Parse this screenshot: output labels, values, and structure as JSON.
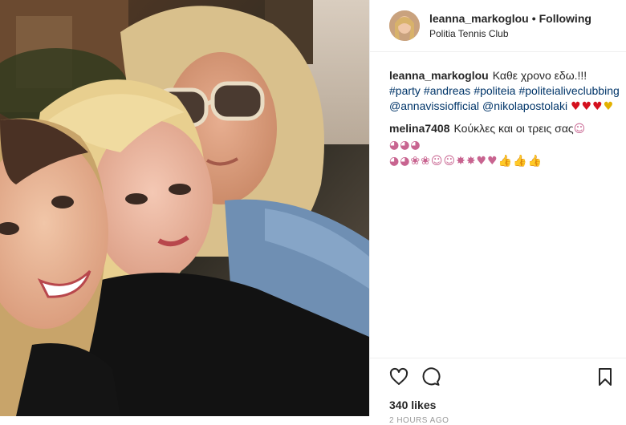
{
  "header": {
    "username": "leanna_markoglou",
    "separator": "•",
    "follow_status": "Following",
    "location": "Politia Tennis Club"
  },
  "caption": {
    "username": "leanna_markoglou",
    "text": "Καθε χρονο εδω.!!!",
    "hashtags": [
      "#party",
      "#andreas",
      "#politeia",
      "#politeialiveclubbing"
    ],
    "mentions": [
      "@annavissiofficial",
      "@nikolapostolaki"
    ],
    "emoji_line1": "♥♥♥",
    "emoji_line2": "♥"
  },
  "comment": {
    "username": "melina7408",
    "text": "Κούκλες και οι τρεις σας",
    "emoji_tail": "☺◕◕◕",
    "emoji_line": "◕◕❀❀☺☺✸✸♥♥👍👍👍"
  },
  "actions": {
    "likes": "340 likes",
    "timestamp": "2 HOURS AGO"
  },
  "icons": {
    "like": "heart-icon",
    "comment": "comment-icon",
    "save": "bookmark-icon"
  }
}
